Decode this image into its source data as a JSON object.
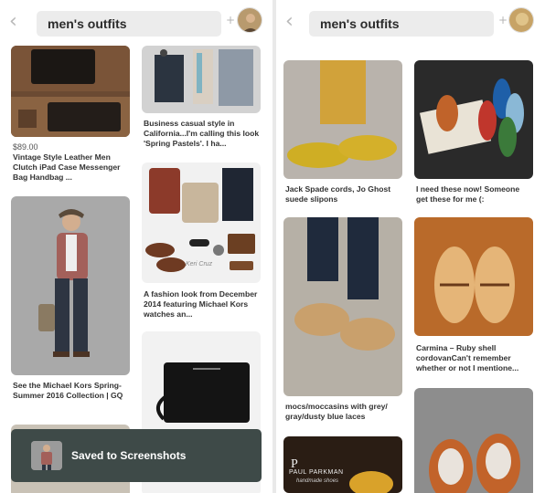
{
  "left_screen": {
    "search_query": "men's outfits",
    "back_icon": "chevron-left-icon",
    "add_icon": "plus-icon",
    "pins": [
      {
        "price": "$89.00",
        "caption": "Vintage Style Leather Men Clutch iPad Case Messenger Bag Handbag ..."
      },
      {
        "caption": "Business casual style in California...I'm calling this look 'Spring Pastels'. I ha..."
      },
      {
        "caption": "See the Michael Kors Spring-Summer 2016 Collection | GQ"
      },
      {
        "caption": "A fashion look from December 2014 featuring Michael Kors watches an...",
        "watermark": "Keri Cruz"
      },
      {
        "caption": ""
      }
    ],
    "toast": {
      "text": "Saved to Screenshots"
    }
  },
  "right_screen": {
    "search_query": "men's outfits",
    "back_icon": "chevron-left-icon",
    "add_icon": "plus-icon",
    "pins": [
      {
        "caption": "Jack Spade cords, Jo Ghost suede slipons"
      },
      {
        "caption": "I need these now! Someone get these for me (:"
      },
      {
        "caption": "mocs/moccasins with grey/ gray/dusty blue laces"
      },
      {
        "caption": "Carmina – Ruby shell cordovanCan't remember whether or not I mentione..."
      },
      {
        "caption": "",
        "brand_text": "PAUL PARKMAN",
        "brand_sub": "handmade shoes"
      },
      {
        "caption": ""
      }
    ]
  },
  "colors": {
    "toast_bg": "#3e4a48",
    "search_bg": "#ececec",
    "icon_gray": "#b8b8b8"
  }
}
